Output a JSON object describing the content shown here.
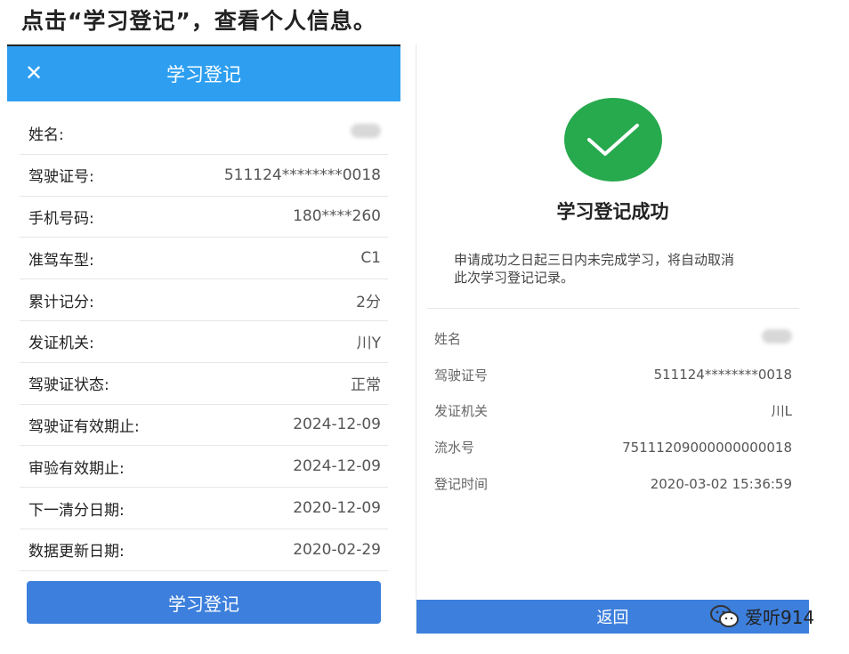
{
  "caption": "点击“学习登记”，查看个人信息。",
  "left": {
    "header_title": "学习登记",
    "rows": [
      {
        "label": "姓名:",
        "value": ""
      },
      {
        "label": "驾驶证号:",
        "value": "511124********0018"
      },
      {
        "label": "手机号码:",
        "value": "180****260"
      },
      {
        "label": "准驾车型:",
        "value": "C1"
      },
      {
        "label": "累计记分:",
        "value": "2分"
      },
      {
        "label": "发证机关:",
        "value": "川Y"
      },
      {
        "label": "驾驶证状态:",
        "value": "正常"
      },
      {
        "label": "驾驶证有效期止:",
        "value": "2024-12-09"
      },
      {
        "label": "审验有效期止:",
        "value": "2024-12-09"
      },
      {
        "label": "下一清分日期:",
        "value": "2020-12-09"
      },
      {
        "label": "数据更新日期:",
        "value": "2020-02-29"
      }
    ],
    "button_label": "学习登记"
  },
  "right": {
    "success_title": "学习登记成功",
    "notice_line1": "申请成功之日起三日内未完成学习，将自动取消",
    "notice_line2": "此次学习登记记录。",
    "rows": [
      {
        "label": "姓名",
        "value": ""
      },
      {
        "label": "驾驶证号",
        "value": "511124********0018"
      },
      {
        "label": "发证机关",
        "value": "川L"
      },
      {
        "label": "流水号",
        "value": "75111209000000000018"
      },
      {
        "label": "登记时间",
        "value": "2020-03-02 15:36:59"
      }
    ],
    "return_label": "返回"
  },
  "watermark": "爱听914",
  "colors": {
    "header_blue": "#2e9ff0",
    "button_blue": "#3d7fdc",
    "success_green": "#27a94d"
  }
}
